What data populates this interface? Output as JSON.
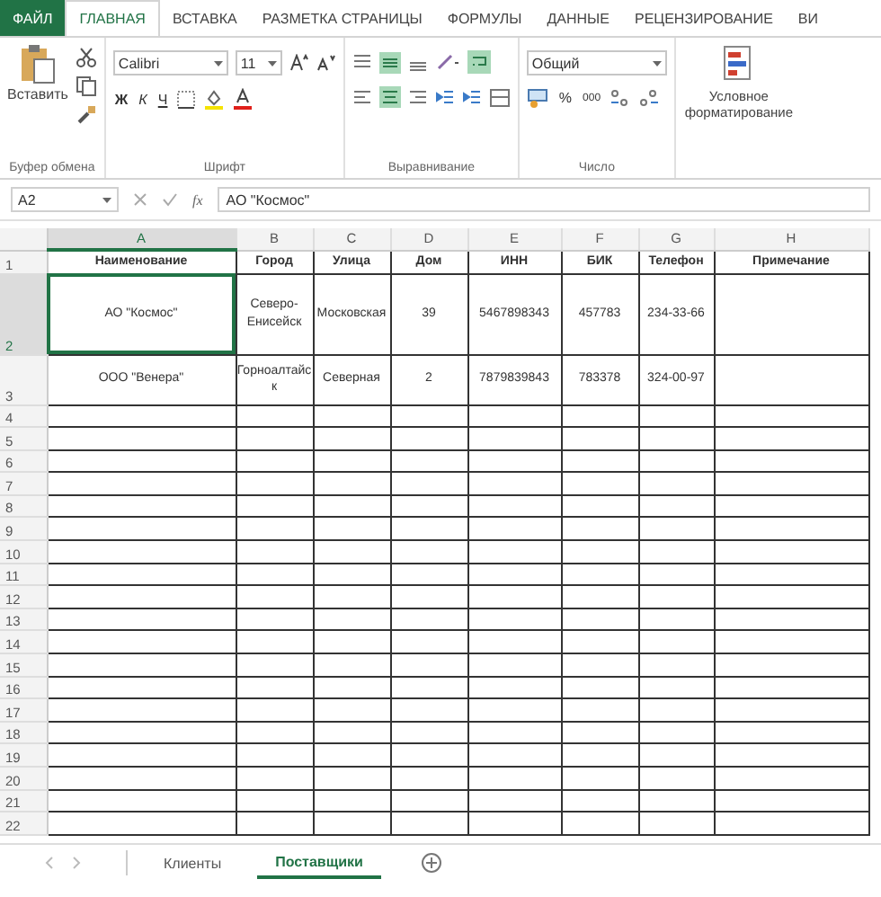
{
  "ribbon_tabs": [
    {
      "label": "ФАЙЛ",
      "kind": "file",
      "selected": false
    },
    {
      "label": "ГЛАВНАЯ",
      "kind": "tab",
      "selected": true
    },
    {
      "label": "ВСТАВКА",
      "kind": "tab",
      "selected": false
    },
    {
      "label": "РАЗМЕТКА СТРАНИЦЫ",
      "kind": "tab",
      "selected": false
    },
    {
      "label": "ФОРМУЛЫ",
      "kind": "tab",
      "selected": false
    },
    {
      "label": "ДАННЫЕ",
      "kind": "tab",
      "selected": false
    },
    {
      "label": "РЕЦЕНЗИРОВАНИЕ",
      "kind": "tab",
      "selected": false
    },
    {
      "label": "ВИ",
      "kind": "tab",
      "selected": false
    }
  ],
  "ribbon": {
    "paste_label": "Вставить",
    "clipboard_label": "Буфер обмена",
    "font_name": "Calibri",
    "font_size": "11",
    "bold": "Ж",
    "italic": "К",
    "underline": "Ч",
    "font_label": "Шрифт",
    "alignment_label": "Выравнивание",
    "number_format": "Общий",
    "percent": "%",
    "thousands": "000",
    "number_label": "Число",
    "conditional_label": "Условное форматирование"
  },
  "formula_bar": {
    "cell_ref": "A2",
    "fx": "fx",
    "value": "АО \"Космос\""
  },
  "columns": [
    {
      "letter": "A",
      "selected": true
    },
    {
      "letter": "B",
      "selected": false
    },
    {
      "letter": "C",
      "selected": false
    },
    {
      "letter": "D",
      "selected": false
    },
    {
      "letter": "E",
      "selected": false
    },
    {
      "letter": "F",
      "selected": false
    },
    {
      "letter": "G",
      "selected": false
    },
    {
      "letter": "H",
      "selected": false
    }
  ],
  "rows": [
    {
      "number": "1",
      "selected": false,
      "kind": "header",
      "cells": [
        "Наименование",
        "Город",
        "Улица",
        "Дом",
        "ИНН",
        "БИК",
        "Телефон",
        "Примечание"
      ]
    },
    {
      "number": "2",
      "selected": true,
      "kind": "data",
      "cells": [
        "АО \"Космос\"",
        "Северо-Енисейск",
        "Московская",
        "39",
        "5467898343",
        "457783",
        "234-33-66"
      ]
    },
    {
      "number": "3",
      "selected": false,
      "kind": "data",
      "cells": [
        "ООО \"Венера\"",
        "Горноалтайск",
        "Северная",
        "2",
        "7879839843",
        "783378",
        "324-00-97"
      ]
    },
    {
      "number": "4",
      "selected": false
    },
    {
      "number": "5",
      "selected": false
    },
    {
      "number": "6",
      "selected": false
    },
    {
      "number": "7",
      "selected": false
    },
    {
      "number": "8",
      "selected": false
    },
    {
      "number": "9",
      "selected": false
    },
    {
      "number": "10",
      "selected": false
    },
    {
      "number": "11",
      "selected": false
    },
    {
      "number": "12",
      "selected": false
    },
    {
      "number": "13",
      "selected": false
    },
    {
      "number": "14",
      "selected": false
    },
    {
      "number": "15",
      "selected": false
    },
    {
      "number": "16",
      "selected": false
    },
    {
      "number": "17",
      "selected": false
    },
    {
      "number": "18",
      "selected": false
    },
    {
      "number": "19",
      "selected": false
    },
    {
      "number": "20",
      "selected": false
    },
    {
      "number": "21",
      "selected": false
    },
    {
      "number": "22",
      "selected": false
    }
  ],
  "sheet_tabs": [
    {
      "label": "Клиенты",
      "selected": false
    },
    {
      "label": "Поставщики",
      "selected": true
    }
  ]
}
